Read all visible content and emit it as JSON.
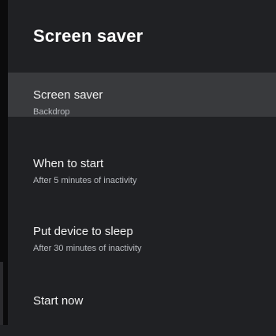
{
  "header": {
    "title": "Screen saver"
  },
  "items": [
    {
      "label": "Screen saver",
      "subtitle": "Backdrop"
    },
    {
      "label": "When to start",
      "subtitle": "After 5 minutes of inactivity"
    },
    {
      "label": "Put device to sleep",
      "subtitle": "After 30 minutes of inactivity"
    },
    {
      "label": "Start now"
    }
  ],
  "colors": {
    "background": "#202124",
    "selected_row": "#393a3d",
    "primary_text": "#f1f1f1",
    "secondary_text": "#b9bcc1"
  }
}
